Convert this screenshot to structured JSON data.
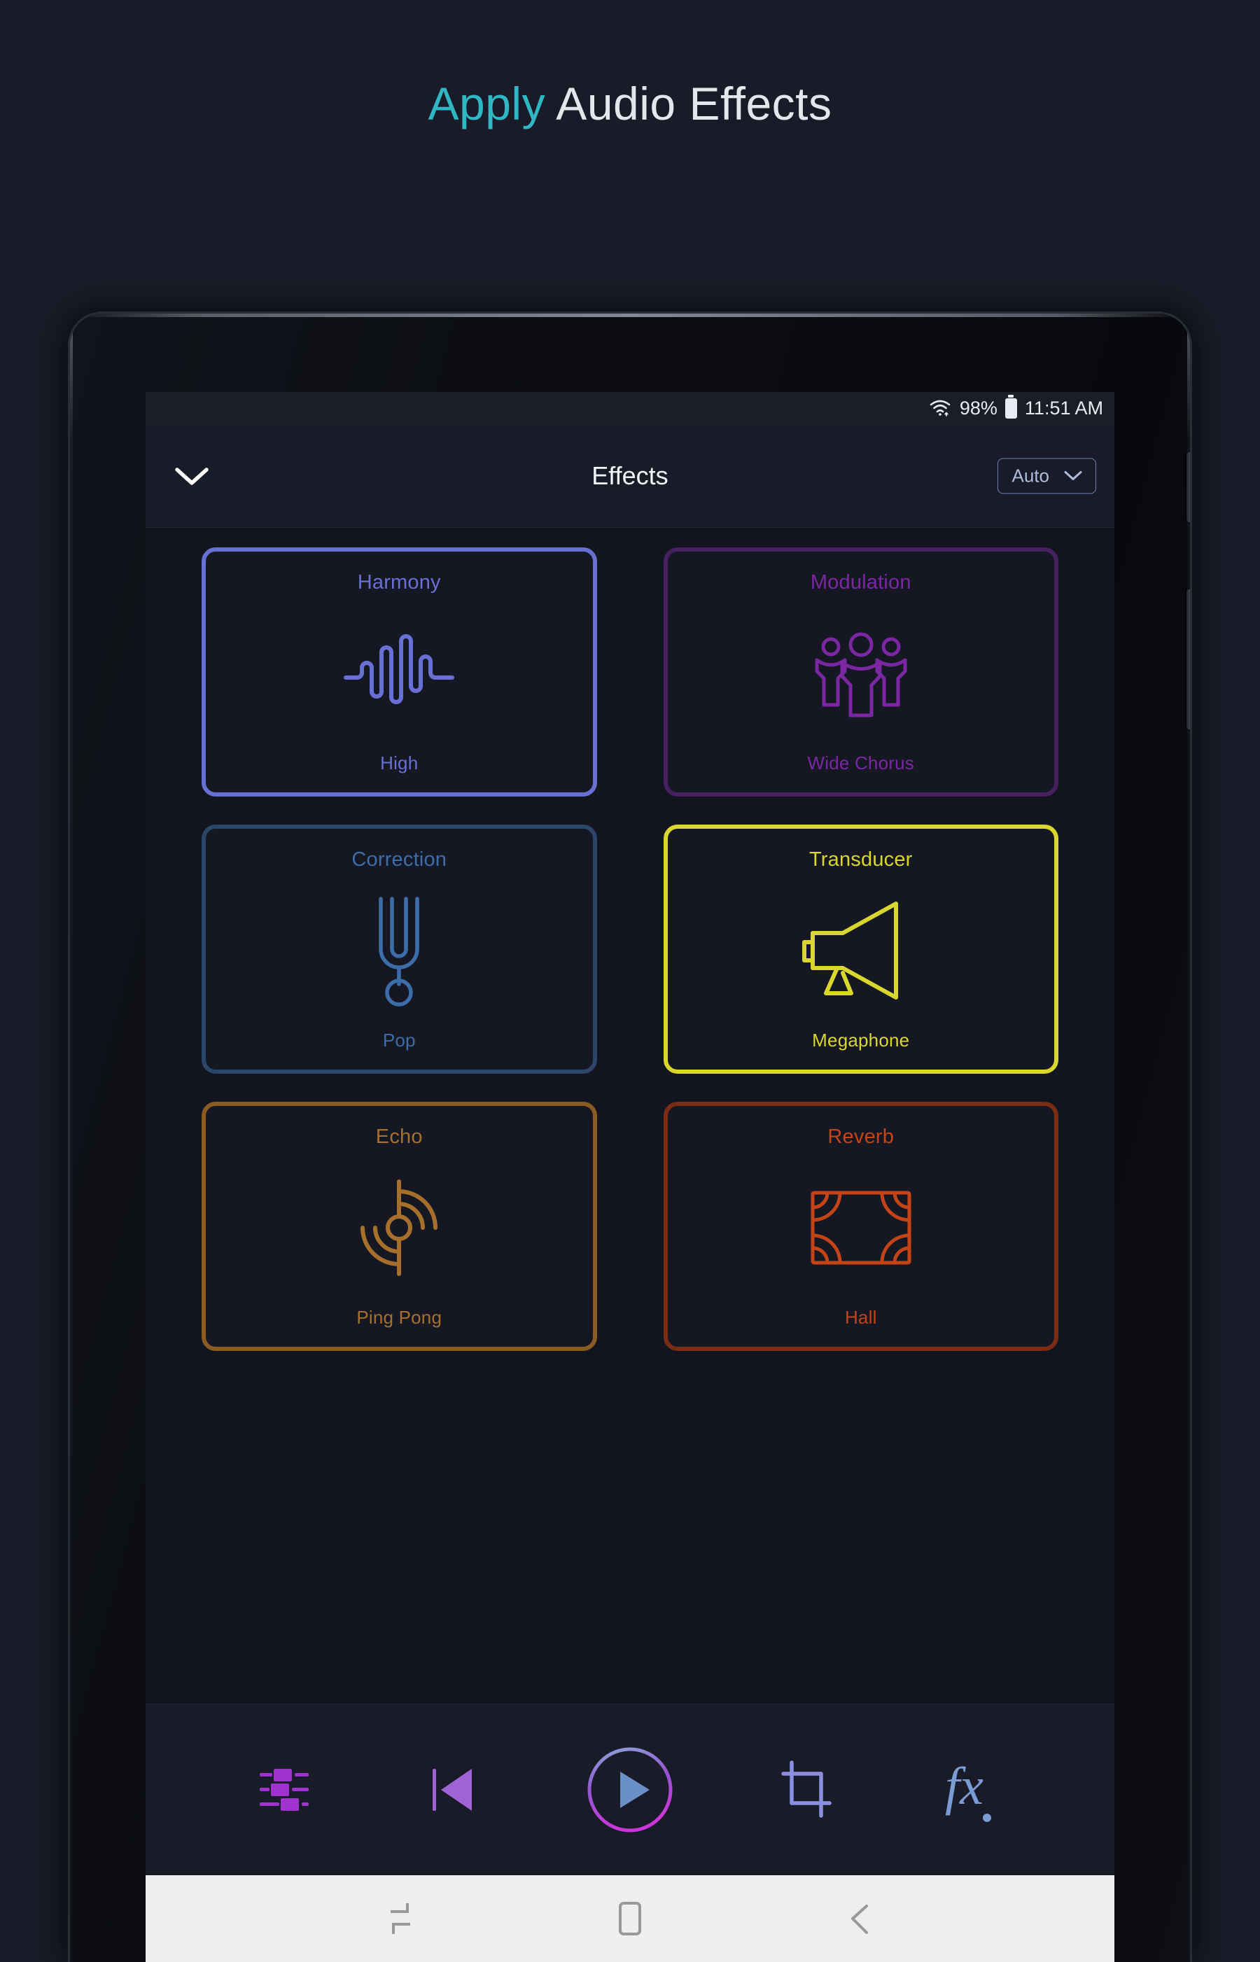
{
  "page": {
    "title_accent": "Apply",
    "title_rest": " Audio Effects",
    "background": "#191c28",
    "accent_color": "#2fb8c4"
  },
  "status_bar": {
    "wifi_icon": "wifi-icon",
    "battery_percent": "98%",
    "battery_icon": "battery-icon",
    "time": "11:51 AM"
  },
  "header": {
    "collapse_icon": "chevron-down-icon",
    "title": "Effects",
    "mode_selector": {
      "label": "Auto",
      "chevron_icon": "chevron-down-icon",
      "border_color": "#6e7fae",
      "text_color": "#aebbdd"
    }
  },
  "effects": [
    {
      "id": "harmony",
      "title": "Harmony",
      "preset": "High",
      "icon": "waveform-icon",
      "color": "#6870d4",
      "border_color": "#6870d4",
      "selected": false
    },
    {
      "id": "modulation",
      "title": "Modulation",
      "preset": "Wide Chorus",
      "icon": "three-people-icon",
      "color": "#7b27a3",
      "border_color": "#472060",
      "selected": false
    },
    {
      "id": "correction",
      "title": "Correction",
      "preset": "Pop",
      "icon": "tuning-fork-icon",
      "color": "#3d6da8",
      "border_color": "#2b4668",
      "selected": false
    },
    {
      "id": "transducer",
      "title": "Transducer",
      "preset": "Megaphone",
      "icon": "megaphone-icon",
      "color": "#d9d62e",
      "border_color": "#d9d62e",
      "selected": true
    },
    {
      "id": "echo",
      "title": "Echo",
      "preset": "Ping Pong",
      "icon": "echo-waves-icon",
      "color": "#a6702c",
      "border_color": "#8a5c24",
      "selected": false
    },
    {
      "id": "reverb",
      "title": "Reverb",
      "preset": "Hall",
      "icon": "room-hall-icon",
      "color": "#c44418",
      "border_color": "#7a2d12",
      "selected": false
    }
  ],
  "toolbar": [
    {
      "id": "mixer",
      "icon": "mixer-sliders-icon",
      "color": "#a033d0"
    },
    {
      "id": "previous",
      "icon": "skip-previous-icon",
      "color": "#9f63d6"
    },
    {
      "id": "play",
      "icon": "play-icon",
      "color": "#6b8fc7"
    },
    {
      "id": "crop",
      "icon": "crop-icon",
      "color": "#8a8fe0"
    },
    {
      "id": "fx",
      "icon": "fx-icon",
      "color": "#7a9bd4"
    }
  ],
  "nav_bar": [
    {
      "id": "recents",
      "icon": "recents-icon"
    },
    {
      "id": "home",
      "icon": "home-square-icon"
    },
    {
      "id": "back",
      "icon": "back-arrow-icon"
    }
  ],
  "device": {
    "camera_icon": "camera-lens-icon",
    "led_icon": "led-indicator-icon",
    "power_button": "power-button",
    "volume_button": "volume-button"
  }
}
